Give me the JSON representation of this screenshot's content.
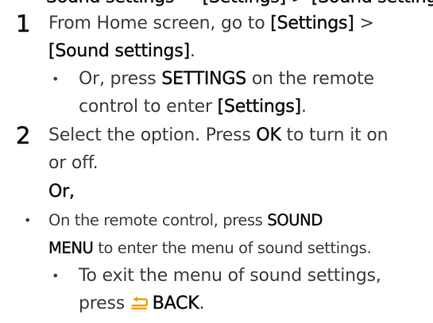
{
  "header_partial": "Sound settings — [Settings] > [Sound settings]",
  "steps": [
    {
      "number": "1",
      "line1_text": "From Home screen, go to ",
      "line1_bold": "[Settings]",
      "line1_tail": " >",
      "line2_bold": "[Sound settings]",
      "line2_tail": ".",
      "sub_bullet": "•",
      "sub_line1_text": "Or, press ",
      "sub_line1_bold": "SETTINGS",
      "sub_line1_tail": " on the remote",
      "sub_line2_text": "control to enter ",
      "sub_line2_bold": "[Settings]",
      "sub_line2_tail": "."
    },
    {
      "number": "2",
      "line1_text": "Select the option. Press ",
      "line1_bold": "OK",
      "line1_tail": " to turn it on",
      "line2_text": "or off."
    }
  ],
  "or_label": "Or,",
  "alt": {
    "bullet": "•",
    "line1_text": "On the remote control, press ",
    "line1_bold": "SOUND",
    "line2_bold": "MENU",
    "line2_tail": " to enter the menu of sound settings.",
    "sub_bullet": "•",
    "sub_line1_text": "To exit the menu of sound settings,",
    "sub_line2_text": "press ",
    "sub_line2_icon": "back-arrow-icon",
    "sub_line2_bold": "BACK",
    "sub_line2_tail": "."
  },
  "colors": {
    "text": "#3d3d3d",
    "bold": "#111111",
    "icon_accent": "#f0a000"
  }
}
